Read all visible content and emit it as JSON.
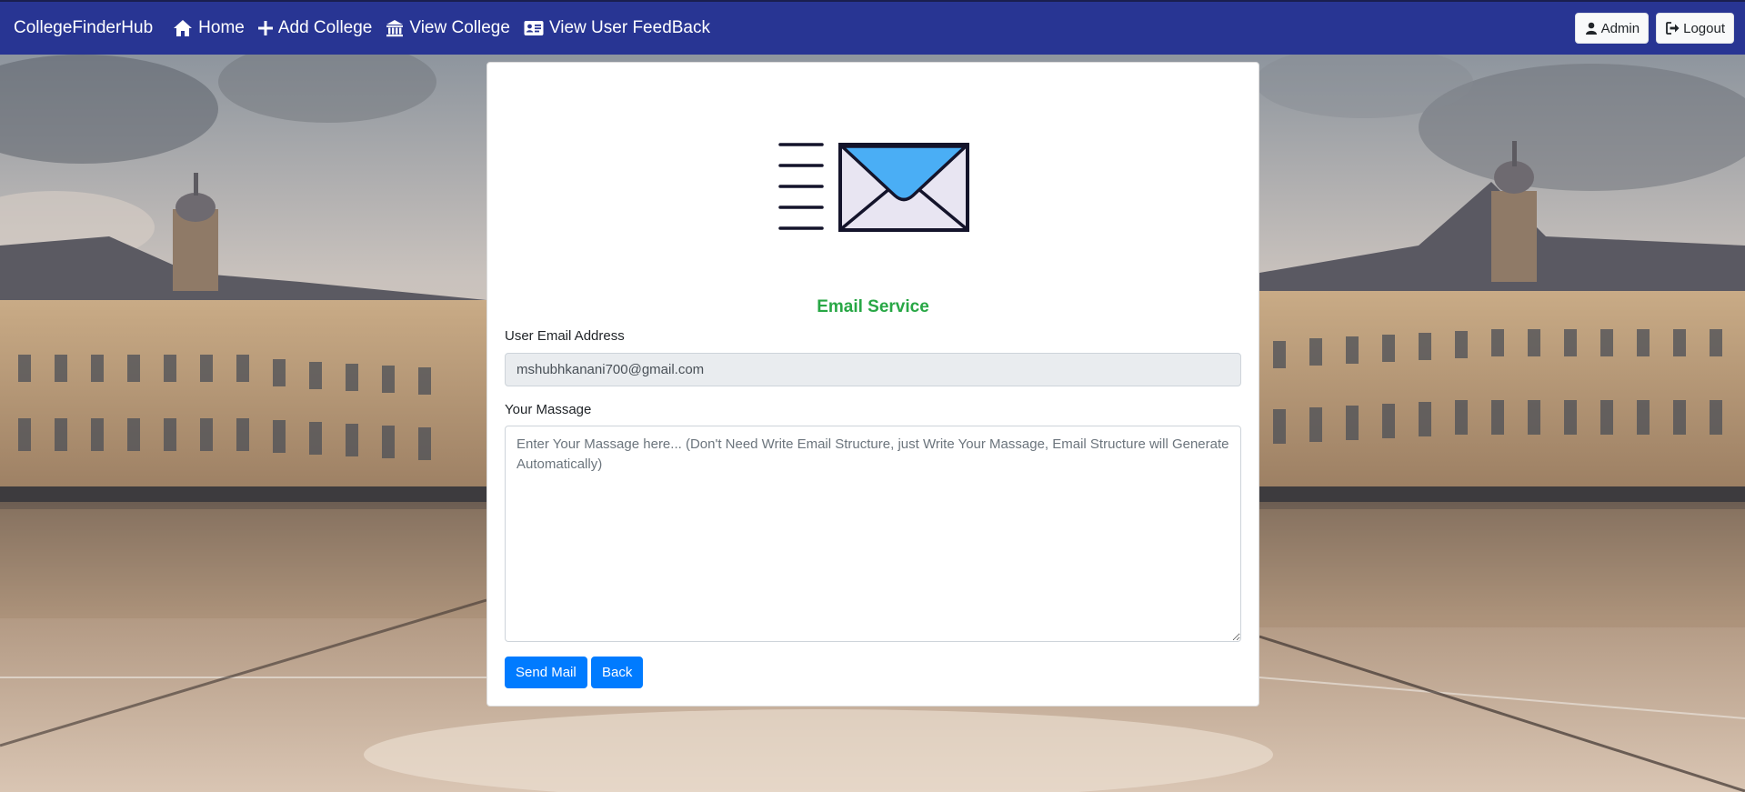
{
  "navbar": {
    "brand": "CollegeFinderHub",
    "links": [
      {
        "label": "Home",
        "icon": "home-icon"
      },
      {
        "label": "Add College",
        "icon": "plus-icon"
      },
      {
        "label": "View College",
        "icon": "bank-icon"
      },
      {
        "label": "View User FeedBack",
        "icon": "id-card-icon"
      }
    ],
    "admin_label": "Admin",
    "logout_label": "Logout",
    "colors": {
      "background": "#283593",
      "text": "#ffffff"
    }
  },
  "form": {
    "title": "Email Service",
    "email_label": "User Email Address",
    "email_value": "mshubhkanani700@gmail.com",
    "message_label": "Your Massage",
    "message_placeholder": "Enter Your Massage here... (Don't Need Write Email Structure, just Write Your Massage, Email Structure will Generate Automatically)",
    "send_label": "Send Mail",
    "back_label": "Back",
    "colors": {
      "title": "#28a745",
      "primary_button": "#007bff"
    }
  },
  "illustration": {
    "icon": "envelope-icon",
    "envelope_flap_color": "#4aaef5"
  }
}
